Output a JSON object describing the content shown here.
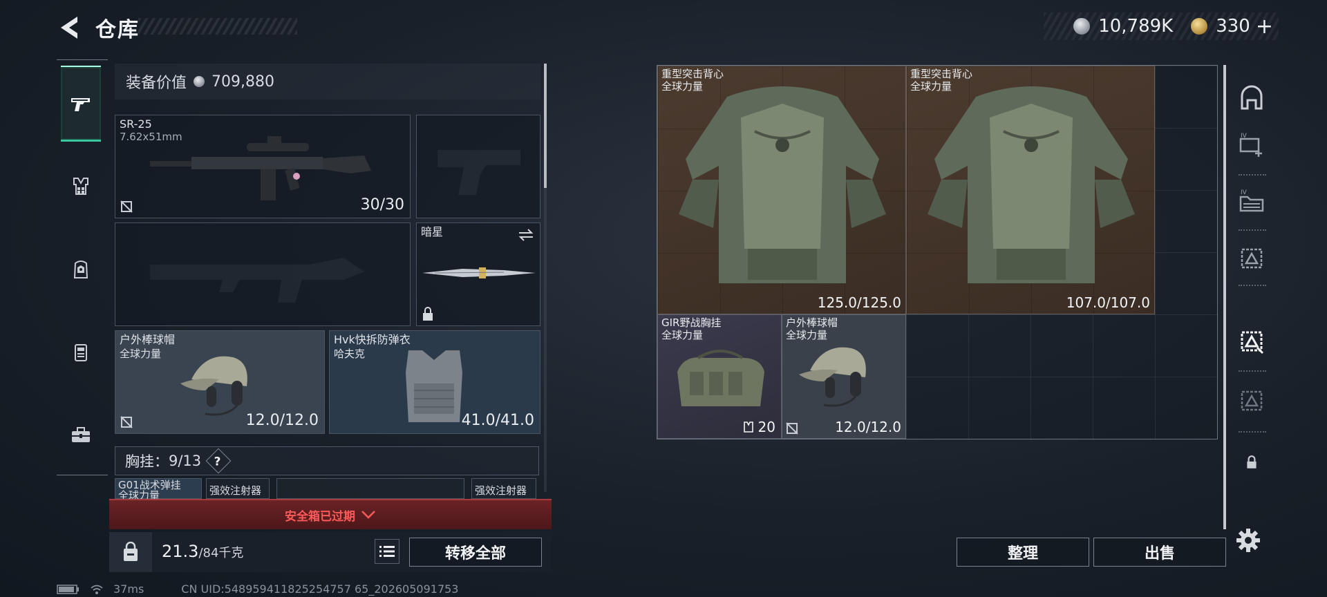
{
  "header": {
    "title": "仓库",
    "currency": [
      {
        "icon": "silver-coin-icon",
        "value": "10,789K"
      },
      {
        "icon": "gold-coin-icon",
        "value": "330"
      }
    ],
    "add_symbol": "+"
  },
  "categories": [
    {
      "icon": "pistol-icon",
      "active": true
    },
    {
      "icon": "vest-icon",
      "active": false
    },
    {
      "icon": "backpack-icon",
      "active": false
    },
    {
      "icon": "armor-icon",
      "active": false
    },
    {
      "icon": "briefcase-icon",
      "active": false
    }
  ],
  "loadout": {
    "equip_value_label": "装备价值",
    "equip_value": "709,880",
    "primary_weapon": {
      "name": "SR-25",
      "caliber": "7.62x51mm",
      "ammo": "30/30"
    },
    "melee": {
      "name": "暗星"
    },
    "helmet": {
      "name": "户外棒球帽",
      "faction": "全球力量",
      "durability": "12.0/12.0"
    },
    "armor": {
      "name": "Hvk快拆防弹衣",
      "faction": "哈夫克",
      "durability": "41.0/41.0"
    },
    "chest_rig": {
      "label": "胸挂：",
      "value": "9/13",
      "help": "?"
    },
    "mini_slots": [
      {
        "name": "G01战术弹挂",
        "faction": "全球力量"
      },
      {
        "name": "强效注射器"
      },
      {
        "name": ""
      },
      {
        "name": "强效注射器"
      }
    ],
    "safe_box_expired": "安全箱已过期",
    "weight": {
      "current": "21.3",
      "max": "/84千克"
    },
    "transfer_all": "转移全部"
  },
  "stash": {
    "items": [
      {
        "name": "重型突击背心",
        "faction": "全球力量",
        "durability": "125.0/125.0"
      },
      {
        "name": "重型突击背心",
        "faction": "全球力量",
        "durability": "107.0/107.0"
      },
      {
        "name": "GIR野战胸挂",
        "faction": "全球力量",
        "capacity": "20"
      },
      {
        "name": "户外棒球帽",
        "faction": "全球力量",
        "durability": "12.0/12.0"
      }
    ],
    "sort_button": "整理",
    "sell_button": "出售"
  },
  "status": {
    "ping": "37ms",
    "uid": "CN UID:548959411825254757 65_202605091753"
  }
}
